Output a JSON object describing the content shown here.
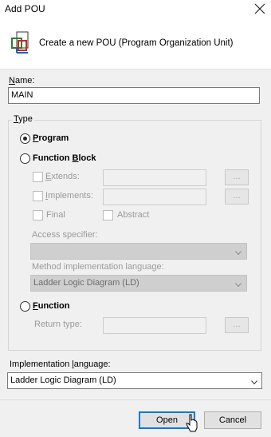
{
  "window": {
    "title": "Add POU"
  },
  "header": {
    "text": "Create a new POU (Program Organization Unit)"
  },
  "name": {
    "label": "Name:",
    "value": "MAIN"
  },
  "type_group": {
    "title": "Type",
    "program": {
      "label": "Program",
      "checked": true
    },
    "function_block": {
      "label": "Function Block",
      "extends_label": "Extends:",
      "implements_label": "Implements:",
      "final_label": "Final",
      "abstract_label": "Abstract",
      "access_specifier_label": "Access specifier:",
      "access_specifier_value": "",
      "method_impl_label": "Method implementation language:",
      "method_impl_value": "Ladder Logic Diagram (LD)",
      "browse": "..."
    },
    "function": {
      "label": "Function",
      "return_type_label": "Return type:",
      "browse": "..."
    }
  },
  "implementation": {
    "label": "Implementation language:",
    "value": "Ladder Logic Diagram (LD)"
  },
  "footer": {
    "open_label": "Open",
    "cancel_label": "Cancel"
  }
}
